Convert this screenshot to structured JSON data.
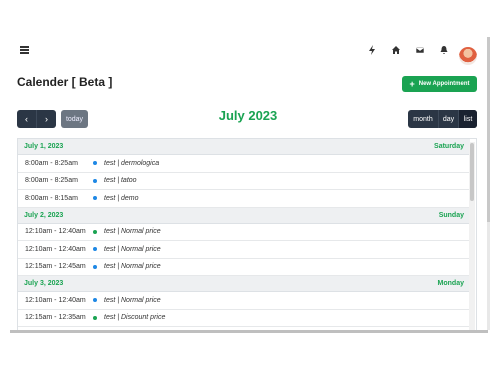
{
  "page": {
    "title": "Calender [ Beta ]",
    "new_button_label": "New Appointment"
  },
  "topbar": {
    "icons": [
      "bolt-icon",
      "home-icon",
      "mail-icon",
      "bell-icon",
      "avatar"
    ]
  },
  "toolbar": {
    "prev_label": "‹",
    "next_label": "›",
    "today_label": "today",
    "title": "July 2023",
    "views": [
      "month",
      "day",
      "list"
    ],
    "active_view": "list"
  },
  "colors": {
    "accent": "#1aa352",
    "dark": "#2b3645",
    "dot_blue": "#1e88e5",
    "dot_green": "#1aa352"
  },
  "days": [
    {
      "date": "July 1, 2023",
      "weekday": "Saturday",
      "events": [
        {
          "time": "8:00am - 8:25am",
          "title": "test | dermologica",
          "dot": "#1e88e5"
        },
        {
          "time": "8:00am - 8:25am",
          "title": "test | tatoo",
          "dot": "#1e88e5"
        },
        {
          "time": "8:00am - 8:15am",
          "title": "test | demo",
          "dot": "#1e88e5"
        }
      ]
    },
    {
      "date": "July 2, 2023",
      "weekday": "Sunday",
      "events": [
        {
          "time": "12:10am - 12:40am",
          "title": "test | Normal price",
          "dot": "#1aa352"
        },
        {
          "time": "12:10am - 12:40am",
          "title": "test | Normal price",
          "dot": "#1e88e5"
        },
        {
          "time": "12:15am - 12:45am",
          "title": "test | Normal price",
          "dot": "#1e88e5"
        }
      ]
    },
    {
      "date": "July 3, 2023",
      "weekday": "Monday",
      "events": [
        {
          "time": "12:10am - 12:40am",
          "title": "test | Normal price",
          "dot": "#1e88e5"
        },
        {
          "time": "12:15am - 12:35am",
          "title": "test | Discount price",
          "dot": "#1aa352"
        }
      ]
    }
  ]
}
